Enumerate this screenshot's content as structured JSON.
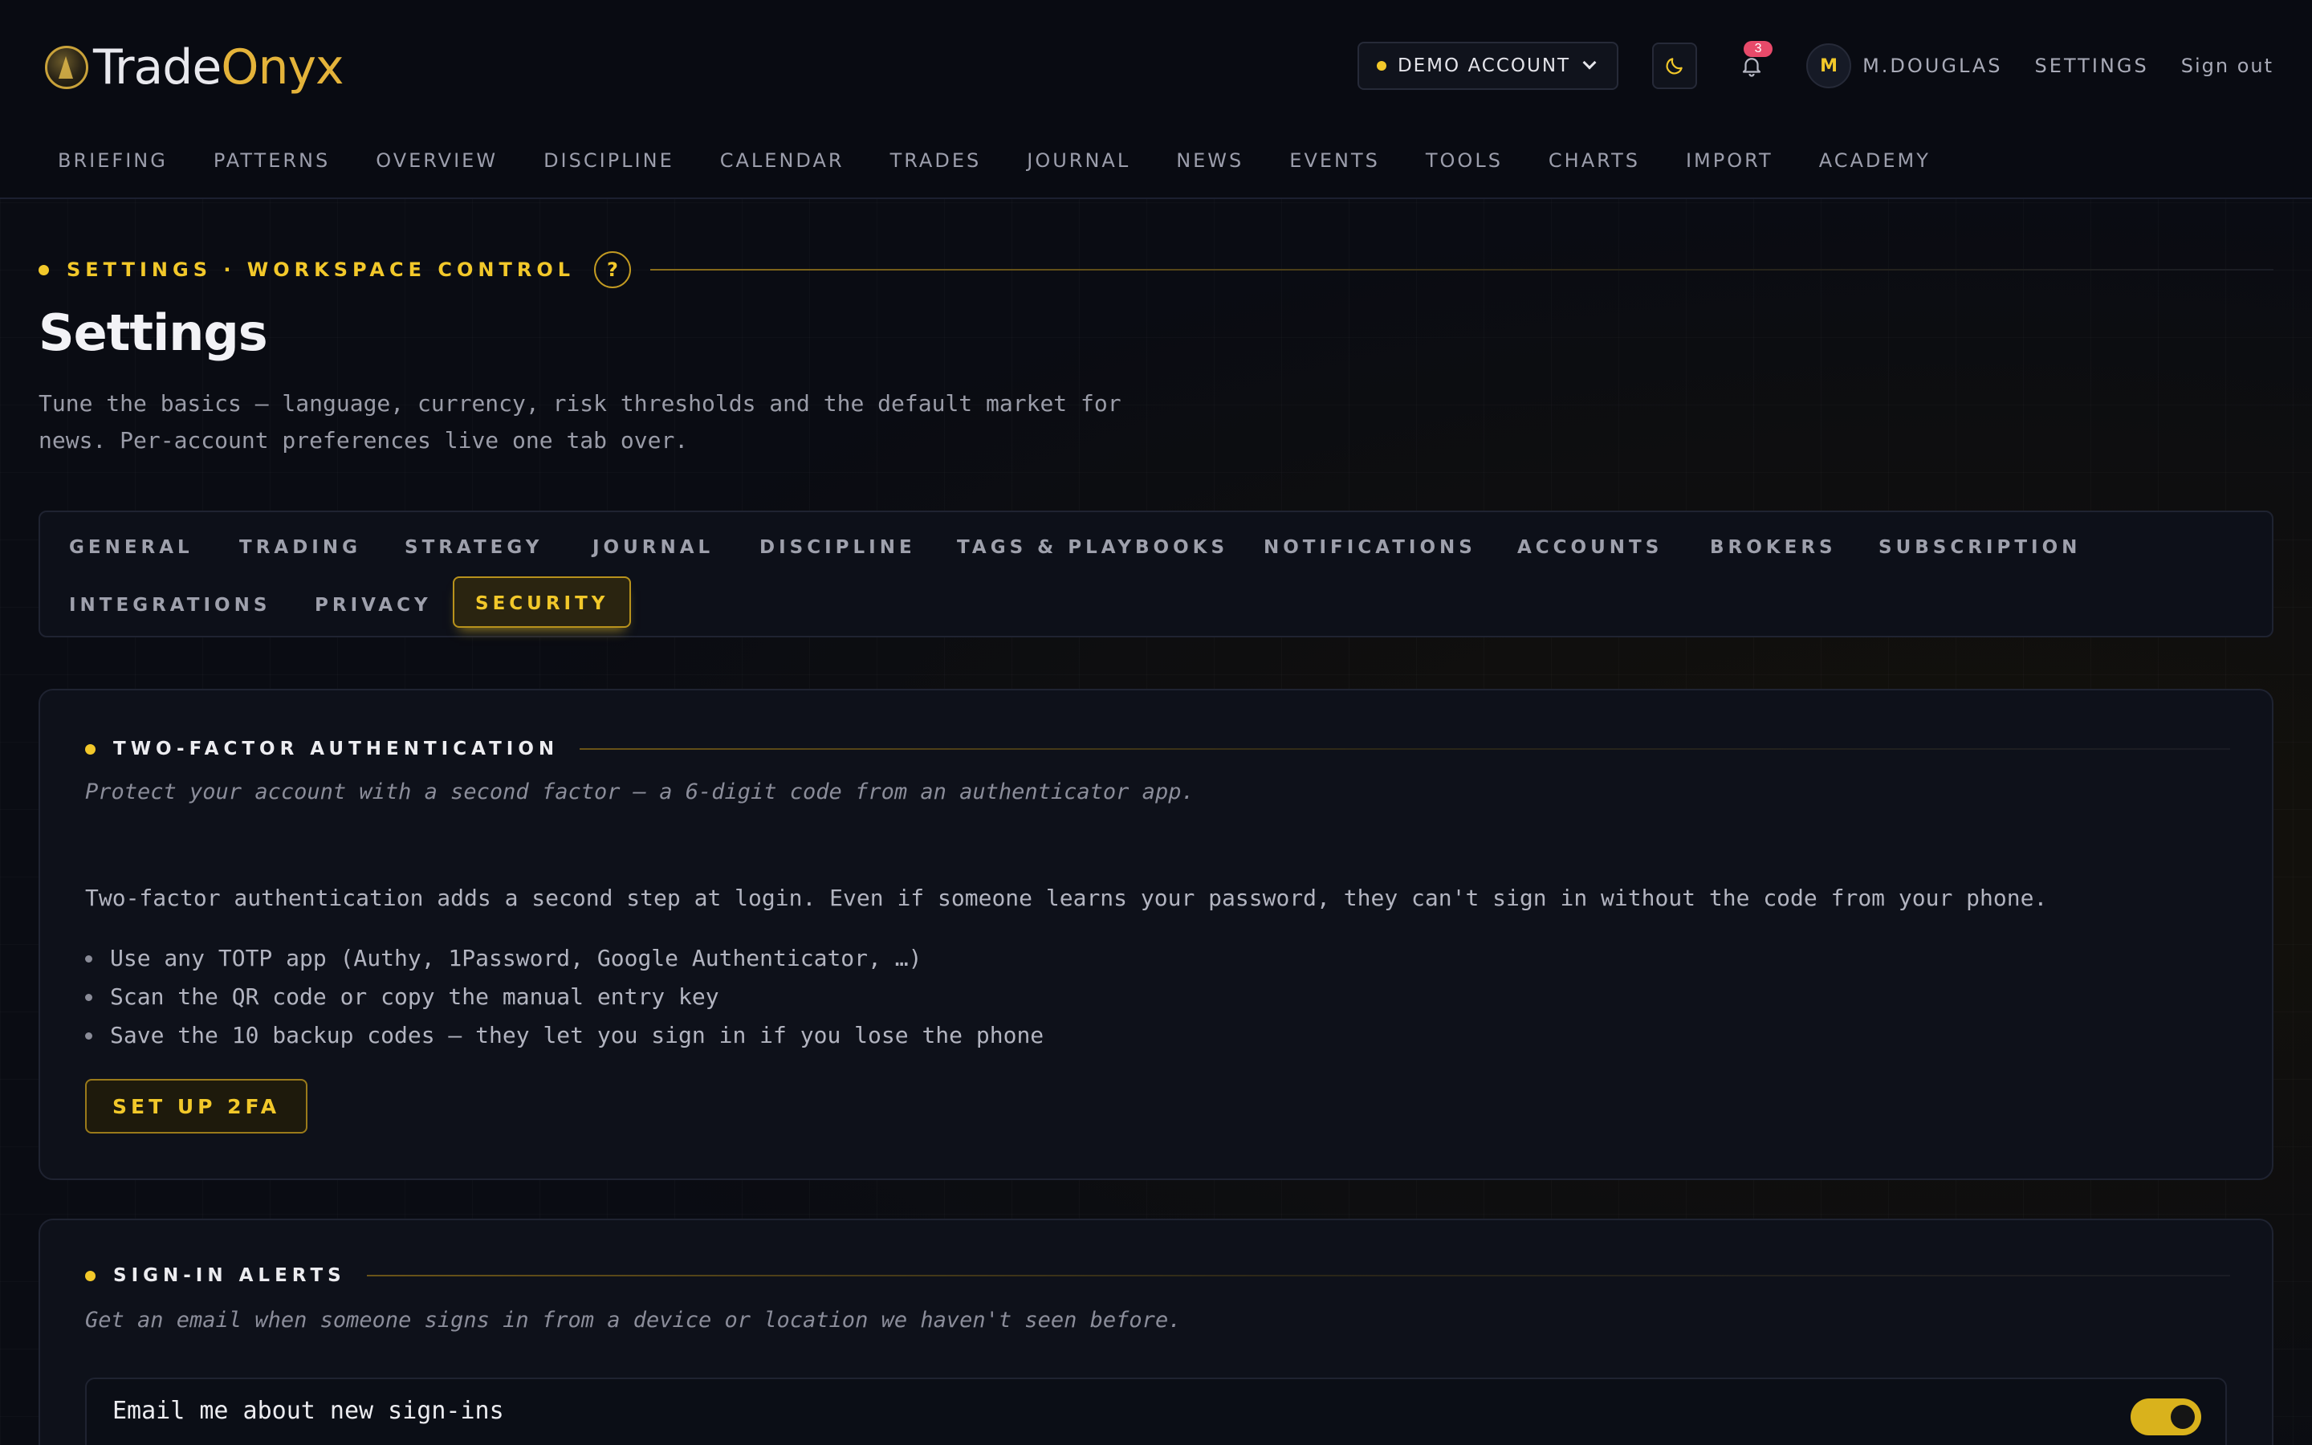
{
  "header": {
    "brand_part1": "Trade",
    "brand_part2": "Onyx",
    "account_selector": "DEMO ACCOUNT",
    "notification_count": "3",
    "avatar_initial": "M",
    "username": "M.DOUGLAS",
    "settings_link": "SETTINGS",
    "signout_link": "Sign out"
  },
  "nav": [
    "BRIEFING",
    "PATTERNS",
    "OVERVIEW",
    "DISCIPLINE",
    "CALENDAR",
    "TRADES",
    "JOURNAL",
    "NEWS",
    "EVENTS",
    "TOOLS",
    "CHARTS",
    "IMPORT",
    "ACADEMY"
  ],
  "page": {
    "eyebrow": "SETTINGS · WORKSPACE CONTROL",
    "help": "?",
    "title": "Settings",
    "description": "Tune the basics — language, currency, risk thresholds and the default market for news. Per-account preferences live one tab over."
  },
  "tabs": {
    "row1": [
      "GENERAL",
      "TRADING",
      "STRATEGY",
      "JOURNAL",
      "DISCIPLINE",
      "TAGS & PLAYBOOKS",
      "NOTIFICATIONS",
      "ACCOUNTS",
      "BROKERS",
      "SUBSCRIPTION"
    ],
    "row2": [
      "INTEGRATIONS",
      "PRIVACY",
      "SECURITY"
    ],
    "active": "SECURITY"
  },
  "two_factor": {
    "title": "TWO-FACTOR AUTHENTICATION",
    "subtitle": "Protect your account with a second factor — a 6-digit code from an authenticator app.",
    "body": "Two-factor authentication adds a second step at login. Even if someone learns your password, they can't sign in without the code from your phone.",
    "bullets": [
      "Use any TOTP app (Authy, 1Password, Google Authenticator, …)",
      "Scan the QR code or copy the manual entry key",
      "Save the 10 backup codes — they let you sign in if you lose the phone"
    ],
    "button": "SET UP 2FA"
  },
  "signin_alerts": {
    "title": "SIGN-IN ALERTS",
    "subtitle": "Get an email when someone signs in from a device or location we haven't seen before.",
    "row_label": "Email me about new sign-ins",
    "toggle_on": true
  },
  "colors": {
    "accent": "#f2c82a",
    "background": "#0a0c13",
    "badge": "#e84a6a"
  }
}
